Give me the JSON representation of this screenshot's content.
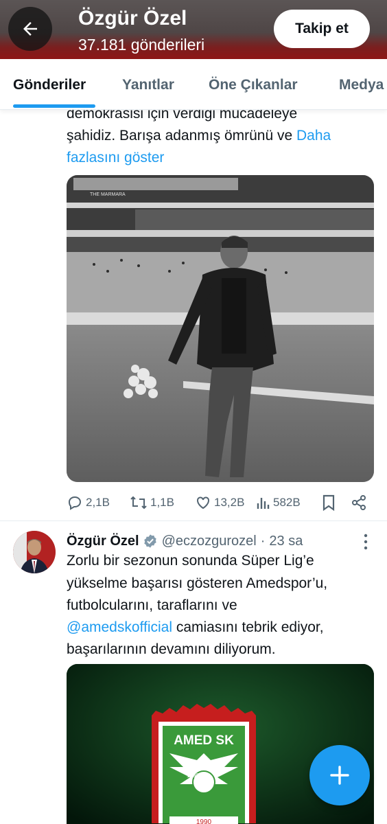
{
  "header": {
    "name": "Özgür Özel",
    "post_count": "37.181 gönderileri",
    "follow_label": "Takip et"
  },
  "tabs": [
    {
      "label": "Gönderiler",
      "active": true
    },
    {
      "label": "Yanıtlar",
      "active": false
    },
    {
      "label": "Öne Çıkanlar",
      "active": false
    },
    {
      "label": "Medya",
      "active": false
    }
  ],
  "tweet1": {
    "line1": "demokrasisi için verdiği mücadeleye",
    "line2": "şahidiz. Barışa adanmış ömrünü ve ",
    "more_link_1": "Daha",
    "more_link_2": "fazlasını göster",
    "image_sign": "THE MARMARA",
    "stats": {
      "replies": "2,1B",
      "reposts": "1,1B",
      "likes": "13,2B",
      "views": "582B"
    }
  },
  "tweet2": {
    "name": "Özgür Özel",
    "handle": "@eczozgurozel",
    "separator": "·",
    "time": "23 sa",
    "line1": "Zorlu bir sezonun sonunda Süper Lig’e",
    "line2": "yükselme başarısı gösteren Amedspor’u,",
    "line3": "futbolcularını, taraflarını ve",
    "mention": "@amedskofficial",
    "line4_rest": " camiasını tebrik ediyor,",
    "line5": "başarılarının devamını diliyorum.",
    "logo_text": "AMED SK",
    "logo_year_top": "1990",
    "logo_year_bottom": "1990"
  },
  "colors": {
    "accent": "#1d9bf0",
    "verified": "#829aab",
    "muted": "#536471",
    "header_red": "#8e1616"
  },
  "icons": [
    "back-arrow-icon",
    "reply-icon",
    "repost-icon",
    "like-icon",
    "views-icon",
    "bookmark-icon",
    "share-icon",
    "verified-badge-icon",
    "more-icon",
    "plus-icon"
  ]
}
